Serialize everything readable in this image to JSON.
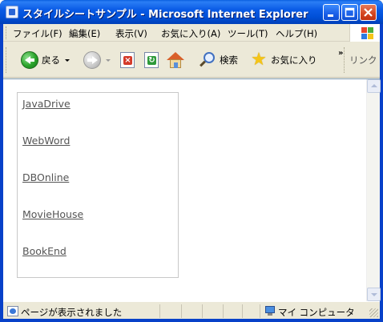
{
  "window": {
    "title": "スタイルシートサンプル - Microsoft Internet Explorer"
  },
  "menu": {
    "items": [
      "ファイル(F)",
      "編集(E)",
      "表示(V)",
      "お気に入り(A)",
      "ツール(T)",
      "ヘルプ(H)"
    ]
  },
  "toolbar": {
    "back_label": "戻る",
    "search_label": "検索",
    "favorites_label": "お気に入り",
    "chevron": "»",
    "links_label": "リンク"
  },
  "content": {
    "links": [
      "JavaDrive",
      "WebWord",
      "DBOnline",
      "MovieHouse",
      "BookEnd"
    ]
  },
  "statusbar": {
    "status_text": "ページが表示されました",
    "zone_text": "マイ コンピュータ"
  },
  "colors": {
    "titlebar": "#0050d8",
    "link": "#555555",
    "chrome": "#ece9d8"
  }
}
